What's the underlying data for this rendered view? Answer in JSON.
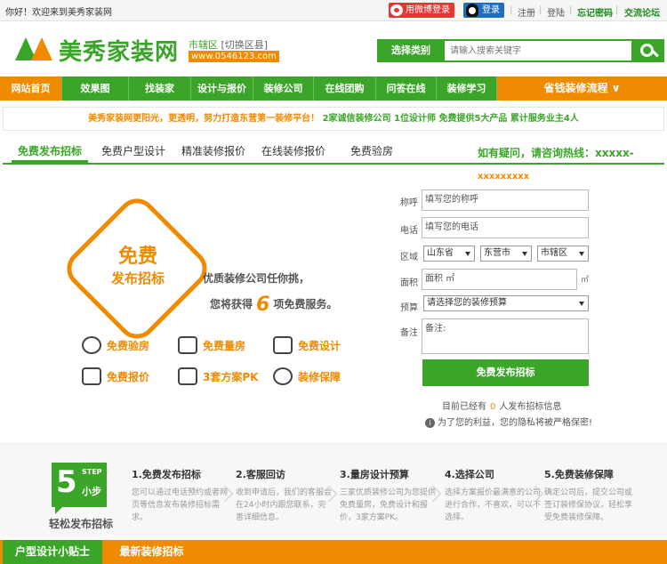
{
  "topbar": {
    "welcome": "你好！欢迎来到美秀家装网",
    "weibo_login": "用微博登录",
    "qq_login": "登录",
    "links": [
      "注册",
      "登陆",
      "忘记密码",
      "交流论坛"
    ]
  },
  "header": {
    "site_name": "美秀家装网",
    "city": "市辖区",
    "switch_city": "[切换区县]",
    "domain": "www.0546123.com",
    "search": {
      "category": "选择类别",
      "placeholder": "请输入搜索关键字"
    }
  },
  "nav": {
    "items": [
      "网站首页",
      "效果图",
      "找装家",
      "设计与报价",
      "装修公司",
      "在线团购",
      "问答在线",
      "装修学习"
    ],
    "flow": "省钱装修流程 ∨"
  },
  "banner": {
    "slogan": "美秀家装网更阳光，更透明，努力打造东营第一装修平台！",
    "highlight": "2家诚信装修公司  1位设计师  免费提供5大产品  累计服务业主4人"
  },
  "tabs": [
    "免费发布招标",
    "免费户型设计",
    "精准装修报价",
    "在线装修报价",
    "免费验房"
  ],
  "hotline": {
    "label": "如有疑问，请咨询热线：xxxxx-",
    "number": "xxxxxxxxx"
  },
  "promo": {
    "badge_line1": "免费",
    "badge_line2": "发布招标",
    "line1": "优质装修公司任你挑，",
    "line2_pre": "您将获得",
    "line2_num": "6",
    "line2_post": "项免费服务。",
    "services": [
      "免费验房",
      "免费量房",
      "免费设计",
      "免费报价",
      "3套方案PK",
      "装修保障"
    ]
  },
  "form": {
    "name_label": "称呼",
    "name_placeholder": "填写您的称呼",
    "phone_label": "电话",
    "phone_placeholder": "填写您的电话",
    "region_label": "区域",
    "province": "山东省",
    "city": "东营市",
    "district": "市辖区",
    "area_label": "面积",
    "area_value": "面积  ㎡",
    "area_unit": "㎡",
    "budget_label": "预算",
    "budget_placeholder": "请选择您的装修预算",
    "note_label": "备注",
    "note_placeholder": "备注:",
    "submit": "免费发布招标",
    "count_pre": "目前已经有",
    "count_num": "0",
    "count_post": "人发布招标信息",
    "privacy": "为了您的利益，您的隐私将被严格保密!"
  },
  "steps": {
    "badge_num": "5",
    "badge_step": "STEP",
    "badge_xb": "小步",
    "caption": "轻松发布招标",
    "items": [
      {
        "title": "1.免费发布招标",
        "desc": "您可以通过电话预约或者网页等信息发布装修招标需求。"
      },
      {
        "title": "2.客服回访",
        "desc": "收到申请后，我们的客服会在24小时内跟您联系，完善详细信息。"
      },
      {
        "title": "3.量房设计预算",
        "desc": "三家优质装修公司为您提供免费量房，免费设计和报价，3家方案PK。"
      },
      {
        "title": "4.选择公司",
        "desc": "选择方案报价最满意的公司进行合作，不喜欢，可以不选择。"
      },
      {
        "title": "5.免费装修保障",
        "desc": "确定公司后，提交公司或签订装修保协议，轻松享受免费装修保障。"
      }
    ]
  },
  "bottom_tabs": [
    "户型设计小贴士",
    "最新装修招标"
  ],
  "colors": {
    "green": "#3aa528",
    "orange": "#f08a00"
  }
}
